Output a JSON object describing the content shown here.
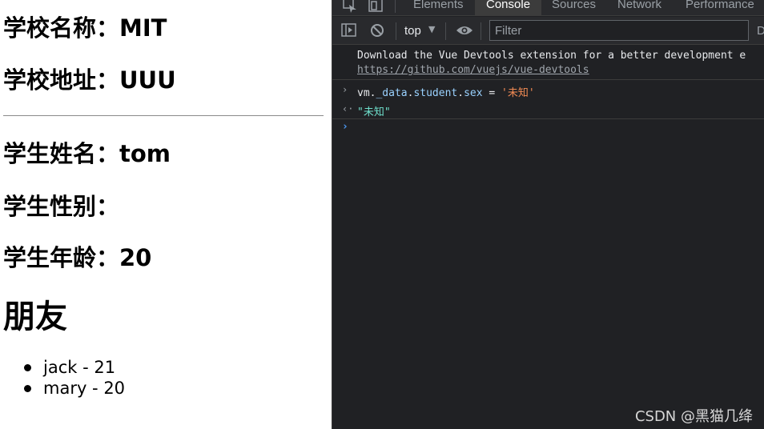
{
  "page": {
    "school_name": "学校名称：MIT",
    "school_address": "学校地址：UUU",
    "student_name": "学生姓名：tom",
    "student_sex": "学生性别：",
    "student_age": "学生年龄：20",
    "friends_heading": "朋友",
    "friends": [
      {
        "text": "jack - 21"
      },
      {
        "text": "mary - 20"
      }
    ]
  },
  "devtools": {
    "tabs": [
      {
        "label": "Elements"
      },
      {
        "label": "Console"
      },
      {
        "label": "Sources"
      },
      {
        "label": "Network"
      },
      {
        "label": "Performance"
      }
    ],
    "active_tab": "Console",
    "toolbar": {
      "context": "top",
      "filter_placeholder": "Filter",
      "levels_label": "D"
    },
    "console": {
      "info_text": "Download the Vue Devtools extension for a better development e",
      "info_link": "https://github.com/vuejs/vue-devtools",
      "input_gutter": "›",
      "input_code": {
        "part1": "vm.",
        "part2": "_data",
        "part3": ".",
        "part4": "student",
        "part5": ".",
        "part6": "sex",
        "part7": " = ",
        "part8": "'未知'"
      },
      "result_gutter": "‹·",
      "result_value": "\"未知\"",
      "prompt_caret": "›"
    }
  },
  "watermark": "CSDN @黑猫几绛",
  "colors": {
    "devtools_bg": "#202124",
    "toolbar_bg": "#292a2d",
    "string": "#f28b54",
    "property": "#9ad2ff",
    "result": "#6fe0cc",
    "prompt": "#4d9cf8"
  }
}
